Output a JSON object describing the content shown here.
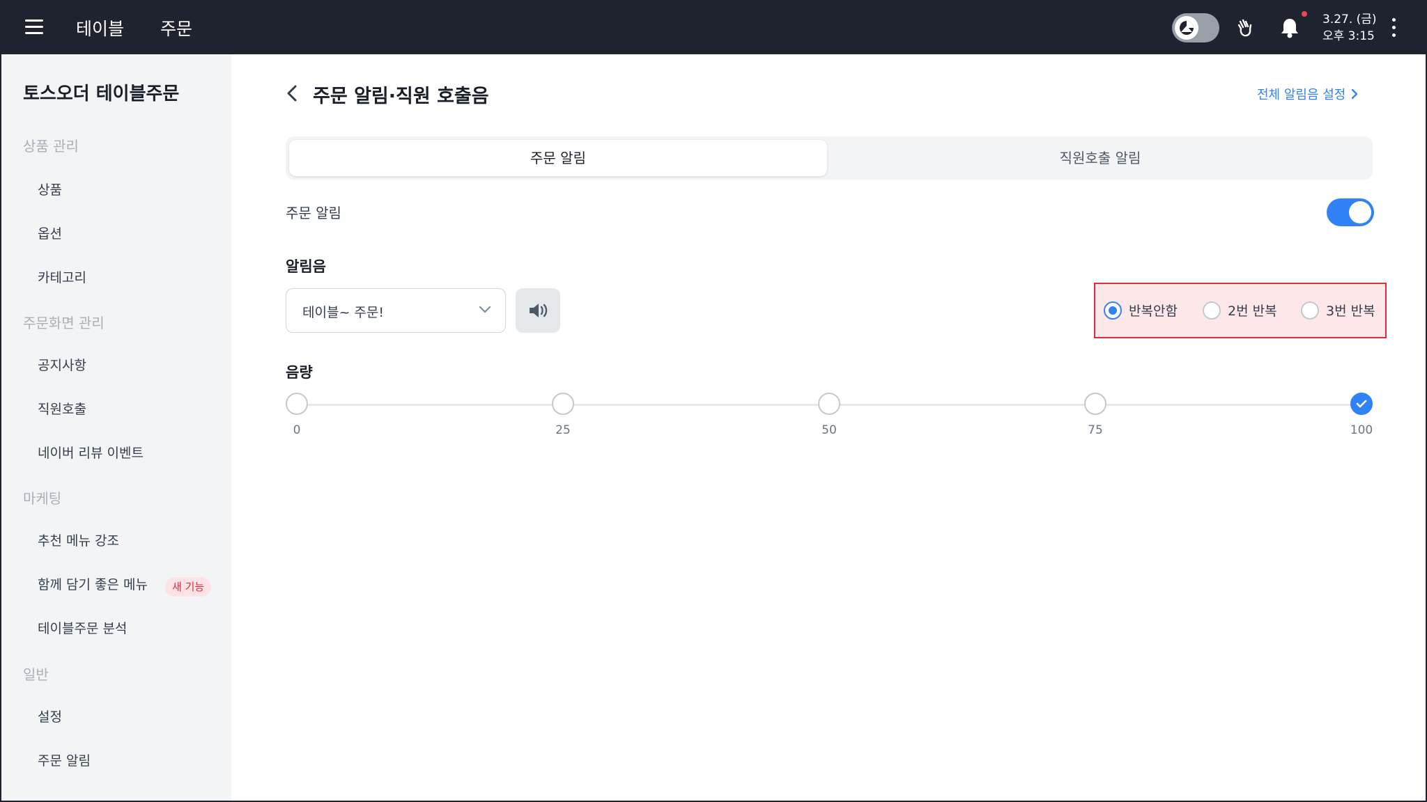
{
  "topbar": {
    "tabs": [
      "테이블",
      "주문"
    ],
    "date": "3.27. (금)",
    "time": "오후 3:15",
    "icons": [
      "menu-icon",
      "theme-toggle-icon",
      "wave-hand-icon",
      "bell-icon",
      "more-vertical-icon"
    ]
  },
  "sidebar": {
    "store_name": "토스오더 테이블주문",
    "sections": [
      {
        "title": "상품 관리",
        "items": [
          "상품",
          "옵션",
          "카테고리"
        ]
      },
      {
        "title": "주문화면 관리",
        "items": [
          "공지사항",
          "직원호출",
          "네이버 리뷰 이벤트"
        ]
      },
      {
        "title": "마케팅",
        "items": [
          "추천 메뉴 강조",
          "함께 담기 좋은 메뉴",
          "테이블주문 분석"
        ]
      },
      {
        "title": "일반",
        "items": [
          "설정",
          "주문 알림"
        ]
      }
    ],
    "new_badge": "새 기능"
  },
  "main": {
    "title": "주문 알림·직원 호출음",
    "all_settings_link": "전체 알림음 설정",
    "tabs": [
      "주문 알림",
      "직원호출 알림"
    ],
    "order_alert_label": "주문 알림",
    "order_alert_enabled": true,
    "sound_label": "알림음",
    "sound_value": "테이블~ 주문!",
    "repeat_options": [
      "반복안함",
      "2번 반복",
      "3번 반복"
    ],
    "repeat_selected": "반복안함",
    "volume_label": "음량",
    "volume_stops": [
      "0",
      "25",
      "50",
      "75",
      "100"
    ],
    "volume_value": 100
  },
  "colors": {
    "accent": "#3182f6",
    "topbar": "#1f2330",
    "highlight_border": "#e42939",
    "highlight_fill": "#fde7e9"
  }
}
